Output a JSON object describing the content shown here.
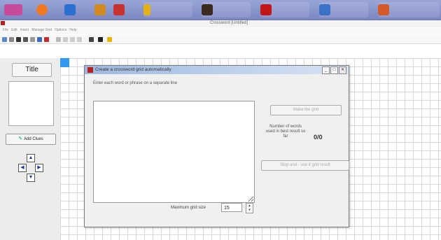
{
  "taskbar": {
    "items": [
      {
        "label": "",
        "color": "#c84a9a"
      },
      {
        "label": "",
        "color": "#f07820"
      },
      {
        "label": "",
        "color": "#2a70d0"
      },
      {
        "label": "",
        "color": "#c8322d"
      },
      {
        "label": "",
        "color": "#e3b210"
      },
      {
        "label": "",
        "color": "#7a6040"
      },
      {
        "label": "",
        "color": "#c01818"
      },
      {
        "label": "",
        "color": "#3a72c8"
      },
      {
        "label": "",
        "color": "#d45a2a"
      }
    ]
  },
  "app": {
    "title": "Crossword [Untitled]"
  },
  "menu": {
    "items": [
      "File",
      "Edit",
      "Insert",
      "Manage Grid",
      "Options",
      "Help"
    ]
  },
  "left_panel": {
    "title_button": "Title",
    "add_class_button": "Add Clues"
  },
  "dialog": {
    "title": "Create a crossword grid automatically",
    "instructions": "Enter each word or phrase on a separate line",
    "words_text": "",
    "create_button": "Make the grid",
    "stats_label": "Number of words used in best result so far",
    "stats_value": "0/0",
    "use_button": "Stop and - use it grid result",
    "max_grid_label": "Maximum grid size",
    "max_grid_value": "15"
  }
}
